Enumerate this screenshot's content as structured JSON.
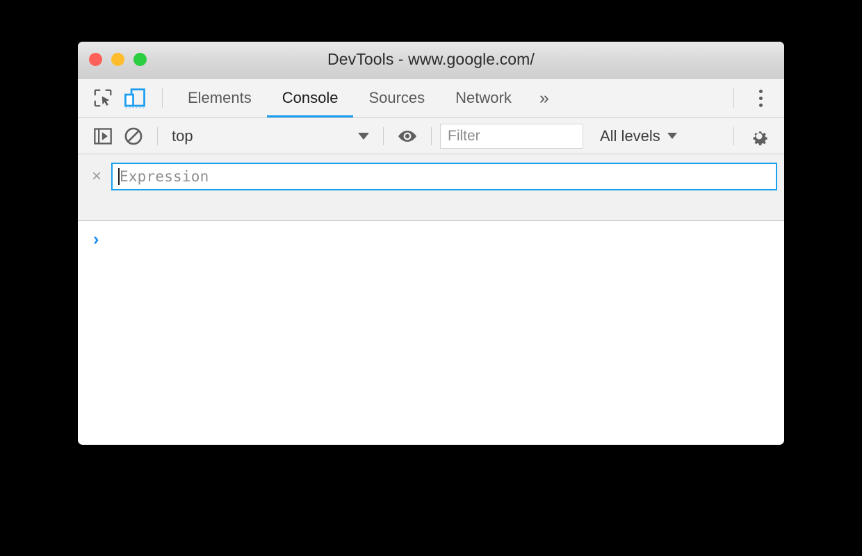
{
  "window": {
    "title": "DevTools - www.google.com/",
    "traffic_lights": [
      {
        "name": "close",
        "color": "#ff6059"
      },
      {
        "name": "minimize",
        "color": "#ffbd2e"
      },
      {
        "name": "maximize",
        "color": "#2bce41"
      }
    ]
  },
  "tabbar": {
    "inspect_icon": "inspect-element-icon",
    "device_icon": "device-toolbar-icon",
    "device_icon_color": "#1a9cf0",
    "tabs": [
      {
        "label": "Elements",
        "active": false
      },
      {
        "label": "Console",
        "active": true
      },
      {
        "label": "Sources",
        "active": false
      },
      {
        "label": "Network",
        "active": false
      }
    ],
    "overflow_label": "»",
    "more_menu_icon": "vertical-dots-icon",
    "active_underline_color": "#1a9cf0"
  },
  "console_toolbar": {
    "sidebar_icon": "console-sidebar-icon",
    "clear_icon": "clear-console-icon",
    "context": {
      "value": "top",
      "caret": "chevron-down-icon"
    },
    "live_expression_icon": "eye-icon",
    "filter": {
      "placeholder": "Filter",
      "value": ""
    },
    "levels": {
      "value": "All levels",
      "caret": "chevron-down-icon"
    },
    "settings_icon": "gear-icon"
  },
  "live_expression": {
    "close_label": "×",
    "placeholder": "Expression",
    "value": "",
    "focused": true,
    "focus_border_color": "#18a0ea"
  },
  "console": {
    "prompt_symbol": "›",
    "prompt_color": "#1a8cf0",
    "messages": []
  }
}
